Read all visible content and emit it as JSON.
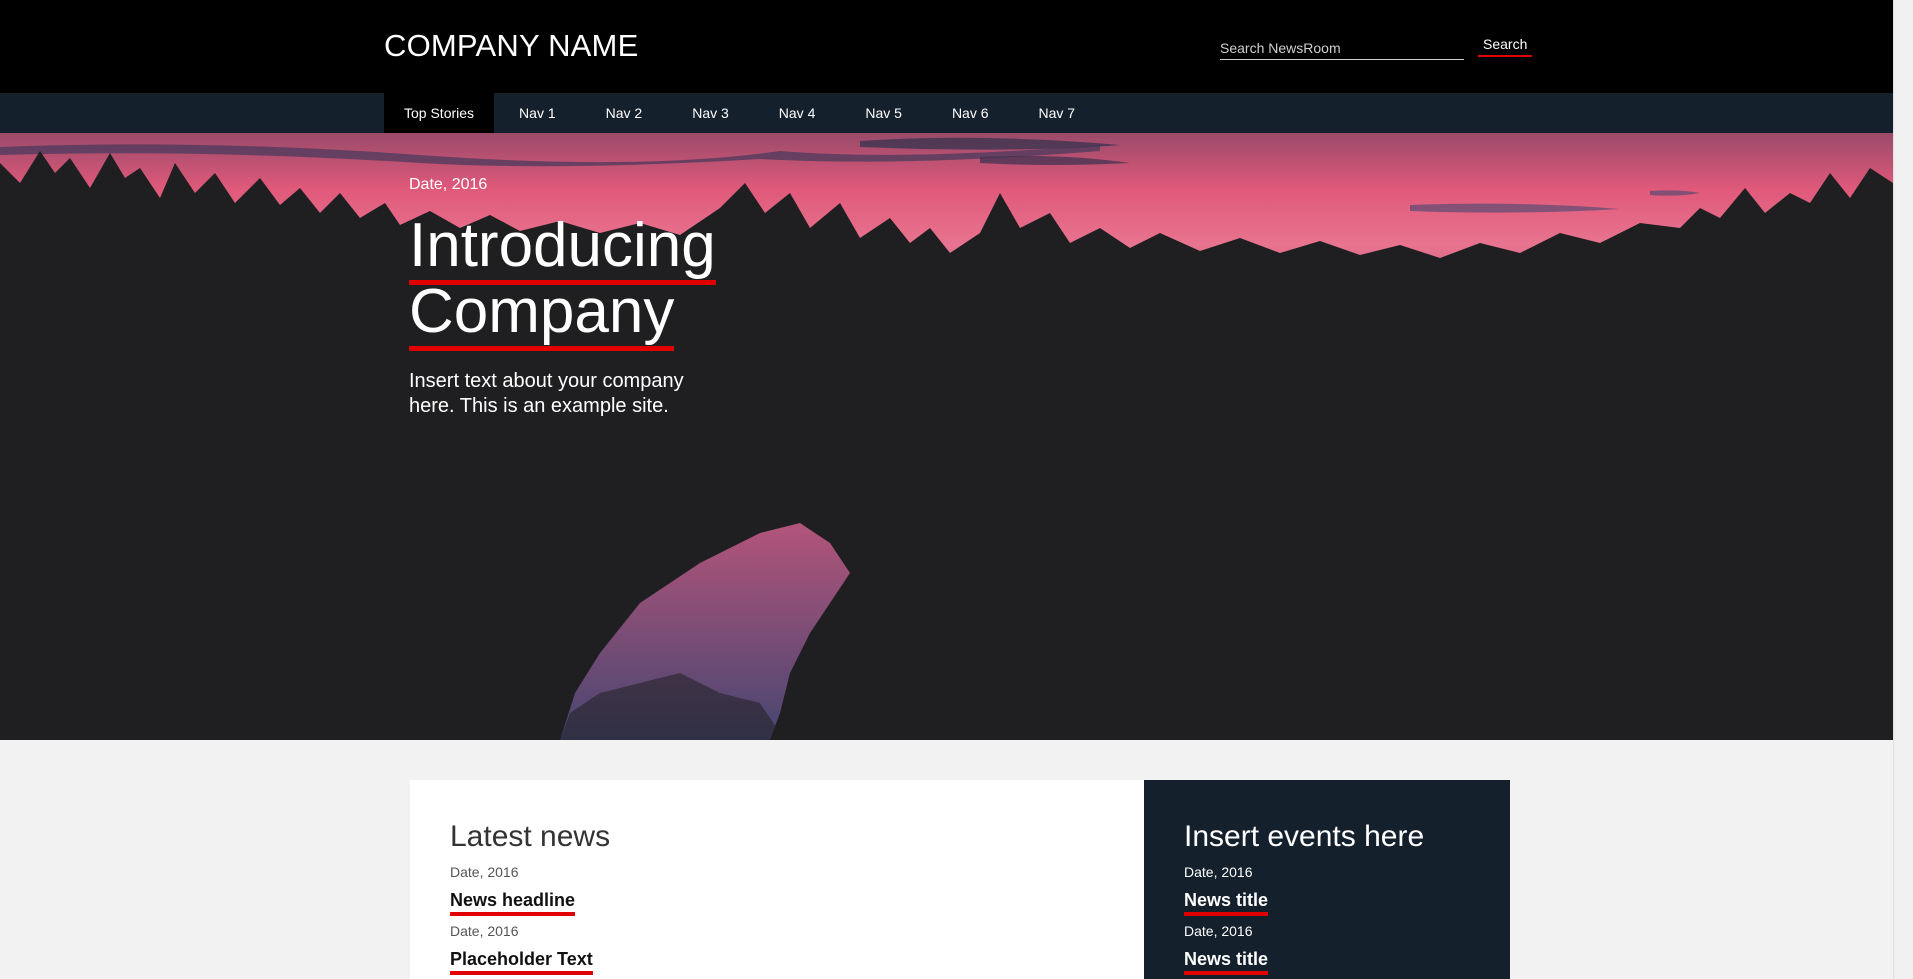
{
  "header": {
    "brand": "COMPANY NAME",
    "search_placeholder": "Search NewsRoom",
    "search_value": "",
    "search_button": "Search"
  },
  "nav": {
    "items": [
      {
        "label": "Top Stories",
        "active": true
      },
      {
        "label": "Nav 1"
      },
      {
        "label": "Nav 2"
      },
      {
        "label": "Nav 3"
      },
      {
        "label": "Nav 4"
      },
      {
        "label": "Nav 5"
      },
      {
        "label": "Nav 6"
      },
      {
        "label": "Nav 7"
      }
    ]
  },
  "hero": {
    "date": "Date, 2016",
    "title_line1": "Introducing",
    "title_line2": "Company",
    "text": "Insert text about your company here. This is an example site."
  },
  "news": {
    "title": "Latest news",
    "items": [
      {
        "date": "Date, 2016",
        "headline": "News headline"
      },
      {
        "date": "Date, 2016",
        "headline": "Placeholder Text"
      }
    ]
  },
  "events": {
    "title": "Insert events here",
    "items": [
      {
        "date": "Date, 2016",
        "title": "News title"
      },
      {
        "date": "Date, 2016",
        "title": "News title"
      }
    ]
  },
  "colors": {
    "accent": "#e10000",
    "header_bg": "#000000",
    "nav_bg": "#15202d",
    "page_bg": "#f2f2f2"
  }
}
